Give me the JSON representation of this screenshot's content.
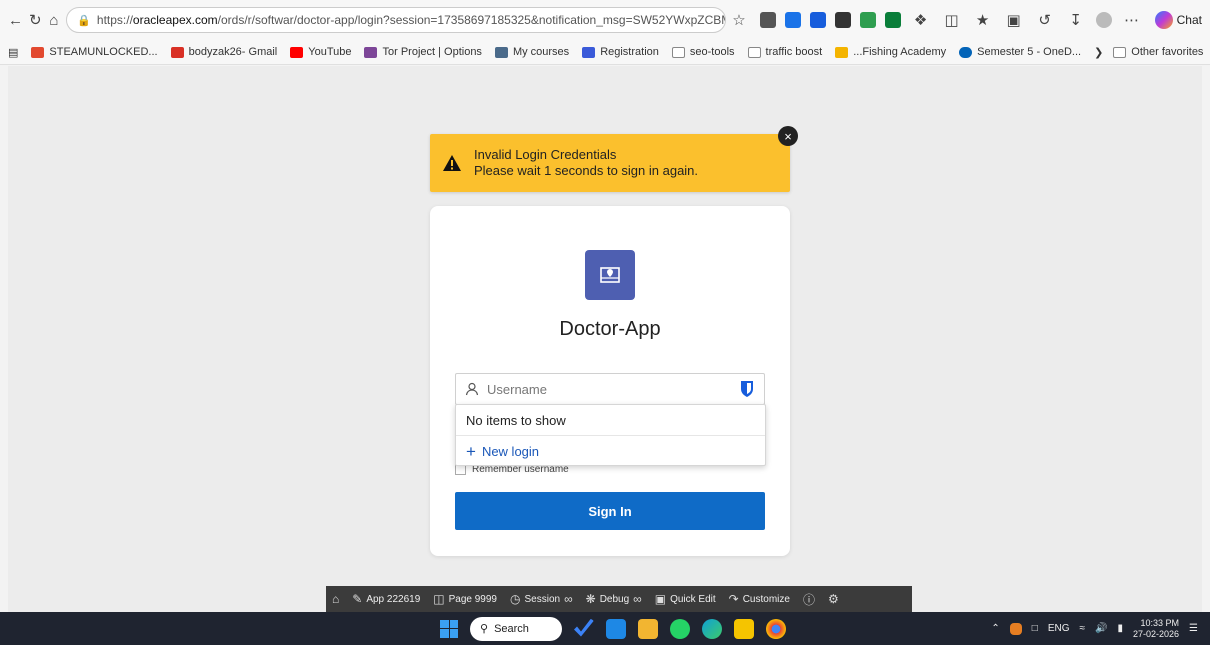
{
  "browser": {
    "url_prefix": "https://",
    "url_host": "oracleapex.com",
    "url_rest": "/ords/r/softwar/doctor-app/login?session=17358697185325&notification_msg=SW52YWxpZCBMb...",
    "chat_label": "Chat"
  },
  "bookmarks": [
    {
      "label": "STEAMUNLOCKED...",
      "color": "#e2492f"
    },
    {
      "label": "bodyzak26- Gmail",
      "color": "#d93025"
    },
    {
      "label": "YouTube",
      "color": "#ff0000"
    },
    {
      "label": "Tor Project | Options",
      "color": "#7d4698"
    },
    {
      "label": "My courses",
      "color": "#4a6a8a"
    },
    {
      "label": "Registration",
      "color": "#3a5ad9"
    },
    {
      "label": "seo-tools",
      "color": "#888888"
    },
    {
      "label": "traffic boost",
      "color": "#888888"
    },
    {
      "label": "...Fishing Academy",
      "color": "#f4b400"
    },
    {
      "label": "Semester 5 - OneD...",
      "color": "#0364b8"
    }
  ],
  "bookmarks_other": "Other favorites",
  "alert": {
    "line1": "Invalid Login Credentials",
    "line2": "Please wait 1 seconds to sign in again.",
    "color": "#fbc02d"
  },
  "login": {
    "app_title": "Doctor-App",
    "username_placeholder": "Username",
    "remember_label": "Remember username",
    "signin_label": "Sign In",
    "accent_color": "#0f6bc7"
  },
  "autofill": {
    "empty_label": "No items to show",
    "new_login_label": "New login"
  },
  "devbar": {
    "app": "App 222619",
    "page": "Page 9999",
    "session": "Session",
    "debug": "Debug",
    "quick_edit": "Quick Edit",
    "customize": "Customize"
  },
  "taskbar": {
    "search_label": "Search",
    "lang": "ENG",
    "time": "10:33 PM",
    "date": "27-02-2026"
  }
}
